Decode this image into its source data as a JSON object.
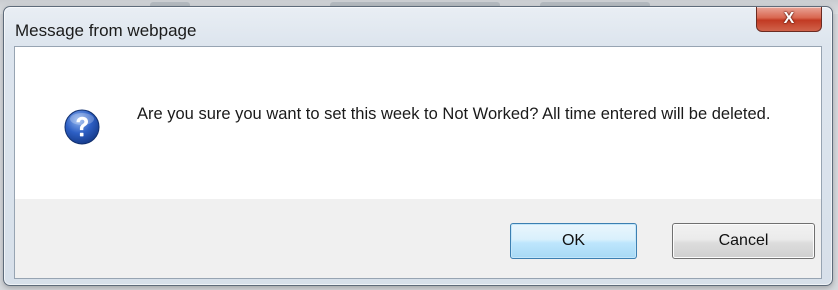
{
  "dialog": {
    "title": "Message from webpage",
    "message": "Are you sure you want to set this week to Not Worked? All time entered will be deleted.",
    "icon": "question-icon",
    "buttons": {
      "ok_label": "OK",
      "cancel_label": "Cancel"
    },
    "close_icon": "close-icon",
    "close_glyph": "X"
  },
  "colors": {
    "close_button": "#c8432b",
    "ok_border": "#3c7fb1",
    "question_icon": "#1f4fb0"
  }
}
